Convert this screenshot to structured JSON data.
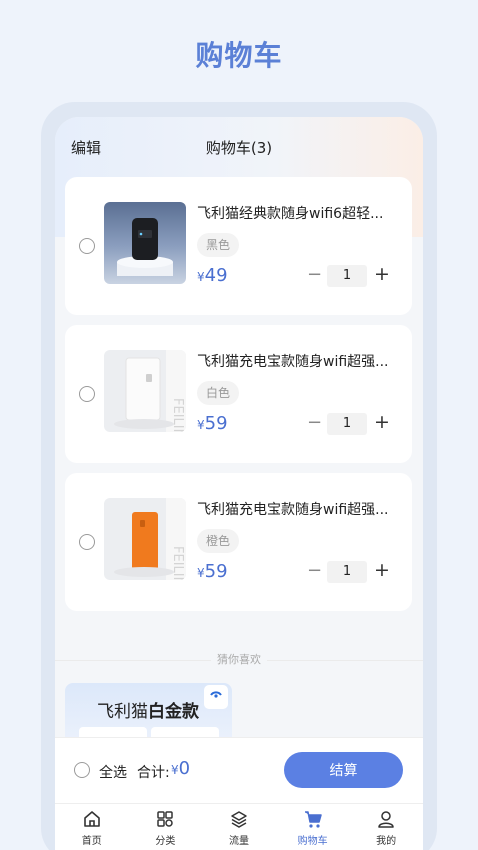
{
  "page_heading": "购物车",
  "topbar": {
    "edit": "编辑",
    "title": "购物车(3)"
  },
  "cart_items": [
    {
      "name": "飞利猫经典款随身wifi6超轻...",
      "variant": "黑色",
      "currency": "¥",
      "price": "49",
      "qty": "1",
      "minus": "−",
      "plus": "+"
    },
    {
      "name": "飞利猫充电宝款随身wifi超强...",
      "variant": "白色",
      "currency": "¥",
      "price": "59",
      "qty": "1",
      "minus": "−",
      "plus": "+"
    },
    {
      "name": "飞利猫充电宝款随身wifi超强...",
      "variant": "橙色",
      "currency": "¥",
      "price": "59",
      "qty": "1",
      "minus": "−",
      "plus": "+"
    }
  ],
  "recommend": {
    "label": "猜你喜欢",
    "card_title_prefix": "飞利猫",
    "card_title_bold": "白金款"
  },
  "checkout": {
    "select_all": "全选",
    "total_label": "合计:",
    "currency": "¥",
    "total": "0",
    "button": "结算"
  },
  "tabs": [
    {
      "label": "首页",
      "icon": "home-icon"
    },
    {
      "label": "分类",
      "icon": "category-icon"
    },
    {
      "label": "流量",
      "icon": "layers-icon"
    },
    {
      "label": "购物车",
      "icon": "cart-icon",
      "active": true
    },
    {
      "label": "我的",
      "icon": "user-icon"
    }
  ],
  "colors": {
    "accent": "#5b80e3",
    "price": "#4a6fd0",
    "heading": "#5b80d6",
    "device_orange": "#f07a1e"
  }
}
